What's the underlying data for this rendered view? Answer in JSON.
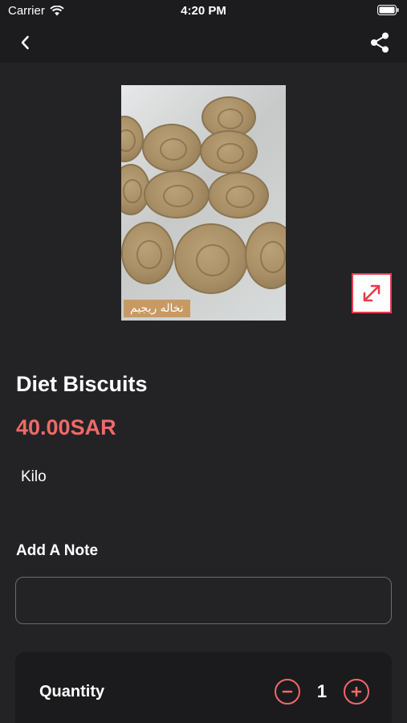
{
  "status_bar": {
    "carrier": "Carrier",
    "time": "4:20 PM"
  },
  "nav": {
    "back_icon": "chevron-left-icon",
    "share_icon": "share-icon"
  },
  "product": {
    "image_caption": "نخاله ريجيم",
    "name": "Diet Biscuits",
    "price": "40.00SAR",
    "unit": "Kilo"
  },
  "note": {
    "label": "Add A Note",
    "value": "",
    "placeholder": ""
  },
  "quantity": {
    "label": "Quantity",
    "value": "1"
  },
  "colors": {
    "background": "#232326",
    "accent": "#f06969",
    "expand_border": "#e63b4b"
  }
}
